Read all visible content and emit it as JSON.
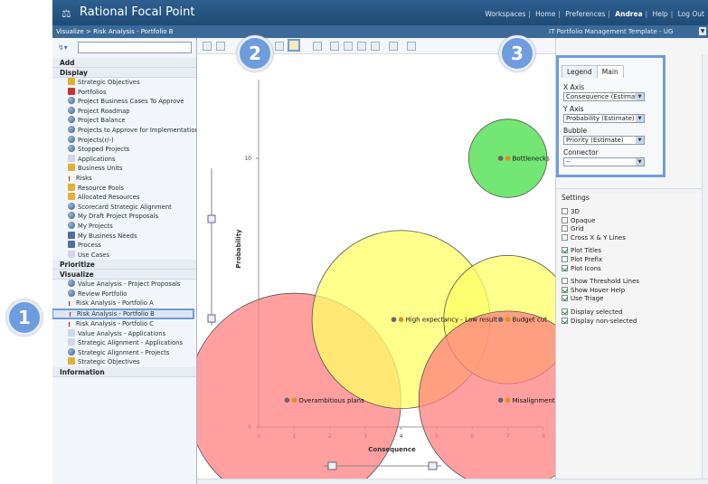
{
  "app": {
    "title": "Rational Focal Point",
    "nav": [
      "Workspaces",
      "Home",
      "Preferences",
      "Andrea",
      "Help",
      "Log Out"
    ],
    "breadcrumb": "Visualize > Risk Analysis - Portfolio B",
    "template": "IT Portfolio Management Template - UG"
  },
  "sidebar": {
    "search_value": "",
    "sections": [
      {
        "label": "Add",
        "items": []
      },
      {
        "label": "Display",
        "items": [
          {
            "label": "Strategic Objectives",
            "icon": "objectives-icon"
          },
          {
            "label": "Portfolios",
            "icon": "portfolios-icon"
          },
          {
            "label": "Project Business Cases To Approve",
            "icon": "globe-icon"
          },
          {
            "label": "Project Roadmap",
            "icon": "globe-icon"
          },
          {
            "label": "Project Balance",
            "icon": "globe-icon"
          },
          {
            "label": "Projects to Approve for Implementation",
            "icon": "globe-icon"
          },
          {
            "label": "Projects(r/-)",
            "icon": "globe-icon"
          },
          {
            "label": "Stopped Projects",
            "icon": "globe-icon"
          },
          {
            "label": "Applications",
            "icon": "star-icon"
          },
          {
            "label": "Business Units",
            "icon": "business-units-icon"
          },
          {
            "label": "Risks",
            "icon": "exclamation-icon"
          },
          {
            "label": "Resource Pools",
            "icon": "resource-pool-icon"
          },
          {
            "label": "Allocated Resources",
            "icon": "person-icon"
          },
          {
            "label": "Scorecard Strategic Alignment",
            "icon": "globe-icon"
          },
          {
            "label": "My Draft Project Proposals",
            "icon": "globe-icon"
          },
          {
            "label": "My Projects",
            "icon": "globe-icon"
          },
          {
            "label": "My Business Needs",
            "icon": "needs-icon"
          },
          {
            "label": "Process",
            "icon": "process-icon"
          },
          {
            "label": "Use Cases",
            "icon": "info-icon"
          }
        ]
      },
      {
        "label": "Prioritize",
        "items": []
      },
      {
        "label": "Visualize",
        "items": [
          {
            "label": "Value Analysis - Project Proposals",
            "icon": "globe-icon"
          },
          {
            "label": "Review Portfolio",
            "icon": "globe-icon"
          },
          {
            "label": "Risk Analysis - Portfolio A",
            "icon": "exclamation-icon"
          },
          {
            "label": "Risk Analysis - Portfolio B",
            "icon": "exclamation-icon",
            "selected": true
          },
          {
            "label": "Risk Analysis - Portfolio C",
            "icon": "exclamation-icon"
          },
          {
            "label": "Value Analysis - Applications",
            "icon": "star-icon"
          },
          {
            "label": "Strategic Alignment - Applications",
            "icon": "star-icon"
          },
          {
            "label": "Strategic Alignment - Projects",
            "icon": "globe-icon"
          },
          {
            "label": "Strategic Objectives",
            "icon": "objectives-icon"
          }
        ]
      },
      {
        "label": "Information",
        "items": []
      }
    ]
  },
  "callouts": [
    "1",
    "2",
    "3"
  ],
  "legend_panel": {
    "tabs": [
      "Legend",
      "Main"
    ],
    "x_axis_label": "X Axis",
    "x_axis_value": "Consequence (Estimate)",
    "y_axis_label": "Y Axis",
    "y_axis_value": "Probability (Estimate)",
    "bubble_label": "Bubble",
    "bubble_value": "Priority (Estimate)",
    "connector_label": "Connector",
    "connector_value": "--"
  },
  "settings": {
    "title": "Settings",
    "options": [
      {
        "label": "3D",
        "checked": false
      },
      {
        "label": "Opaque",
        "checked": false
      },
      {
        "label": "Grid",
        "checked": false
      },
      {
        "label": "Cross X & Y Lines",
        "checked": false
      },
      {
        "label": "Plot Titles",
        "checked": true,
        "gap_before": true
      },
      {
        "label": "Plot Prefix",
        "checked": false
      },
      {
        "label": "Plot Icons",
        "checked": true
      },
      {
        "label": "Show Threshold Lines",
        "checked": false,
        "gap_before": true
      },
      {
        "label": "Show Hover Help",
        "checked": true
      },
      {
        "label": "Use Triage",
        "checked": true
      },
      {
        "label": "Display selected",
        "checked": true,
        "gap_before": true
      },
      {
        "label": "Display non-selected",
        "checked": true
      }
    ]
  },
  "chart_data": {
    "type": "scatter",
    "xlabel": "Consequence",
    "ylabel": "Probability",
    "xlim": [
      0,
      8
    ],
    "ylim": [
      0,
      10
    ],
    "x_ticks": [
      "0",
      "1",
      "2",
      "3",
      "4",
      "5",
      "6",
      "7",
      "8"
    ],
    "y_ticks": [
      "0",
      "10"
    ],
    "bubbles": [
      {
        "label": "Overambitious plans",
        "x": 1,
        "y": 1,
        "r": 3,
        "color": "#ff7f7f"
      },
      {
        "label": "High expectancy - Low result",
        "x": 4,
        "y": 4,
        "r": 2.5,
        "color": "#ffff66"
      },
      {
        "label": "Budget cut",
        "x": 7,
        "y": 4,
        "r": 1.8,
        "color": "#ffff66"
      },
      {
        "label": "Misalignment",
        "x": 7,
        "y": 1,
        "r": 2.5,
        "color": "#ff7f7f"
      },
      {
        "label": "Bottlenecks",
        "x": 7,
        "y": 10,
        "r": 1.1,
        "color": "#44dd44"
      }
    ]
  }
}
